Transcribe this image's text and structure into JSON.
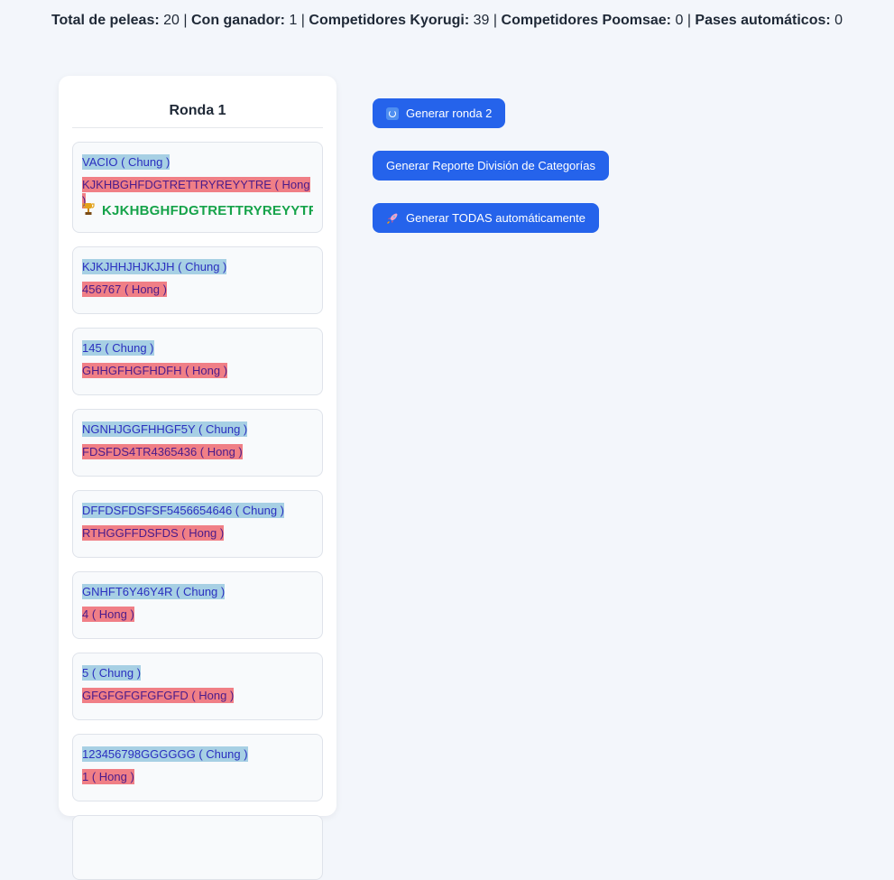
{
  "stats": {
    "total_label": "Total de peleas:",
    "total_value": "20",
    "winner_label": "Con ganador:",
    "winner_value": "1",
    "kyorugi_label": "Competidores Kyorugi:",
    "kyorugi_value": "39",
    "poomsae_label": "Competidores Poomsae:",
    "poomsae_value": "0",
    "passes_label": "Pases automáticos:",
    "passes_value": "0",
    "separator": "|"
  },
  "round": {
    "title": "Ronda 1",
    "fights": [
      {
        "chung": "VACIO ( Chung )",
        "hong": "KJKHBGHFDGTRETTRYREYYTRE ( Hong )",
        "winner": "KJKHBGHFDGTRETTRYREYYTRE"
      },
      {
        "chung": "KJKJHHJHJKJJH ( Chung )",
        "hong": "456767 ( Hong )"
      },
      {
        "chung": "145 ( Chung )",
        "hong": "GHHGFHGFHDFH ( Hong )"
      },
      {
        "chung": "NGNHJGGFHHGF5Y ( Chung )",
        "hong": "FDSFDS4TR4365436 ( Hong )"
      },
      {
        "chung": "DFFDSFDSFSF5456654646 ( Chung )",
        "hong": "RTHGGFFDSFDS ( Hong )"
      },
      {
        "chung": "GNHFT6Y46Y4R ( Chung )",
        "hong": "4 ( Hong )"
      },
      {
        "chung": "5 ( Chung )",
        "hong": "GFGFGFGFGFGFD ( Hong )"
      },
      {
        "chung": "123456798GGGGGG ( Chung )",
        "hong": "1 ( Hong )"
      }
    ]
  },
  "actions": {
    "next_round_label": "Generar ronda 2",
    "report_label": "Generar Reporte División de Categorías",
    "generate_all_label": "Generar TODAS automáticamente"
  },
  "icons": {
    "next_round": "refresh-icon",
    "generate_all": "rocket-icon",
    "winner": "trophy-icon"
  },
  "colors": {
    "primary": "#2563eb",
    "chung": "#a7d0e4",
    "hong": "#f07f86",
    "winner": "#16a34a"
  }
}
